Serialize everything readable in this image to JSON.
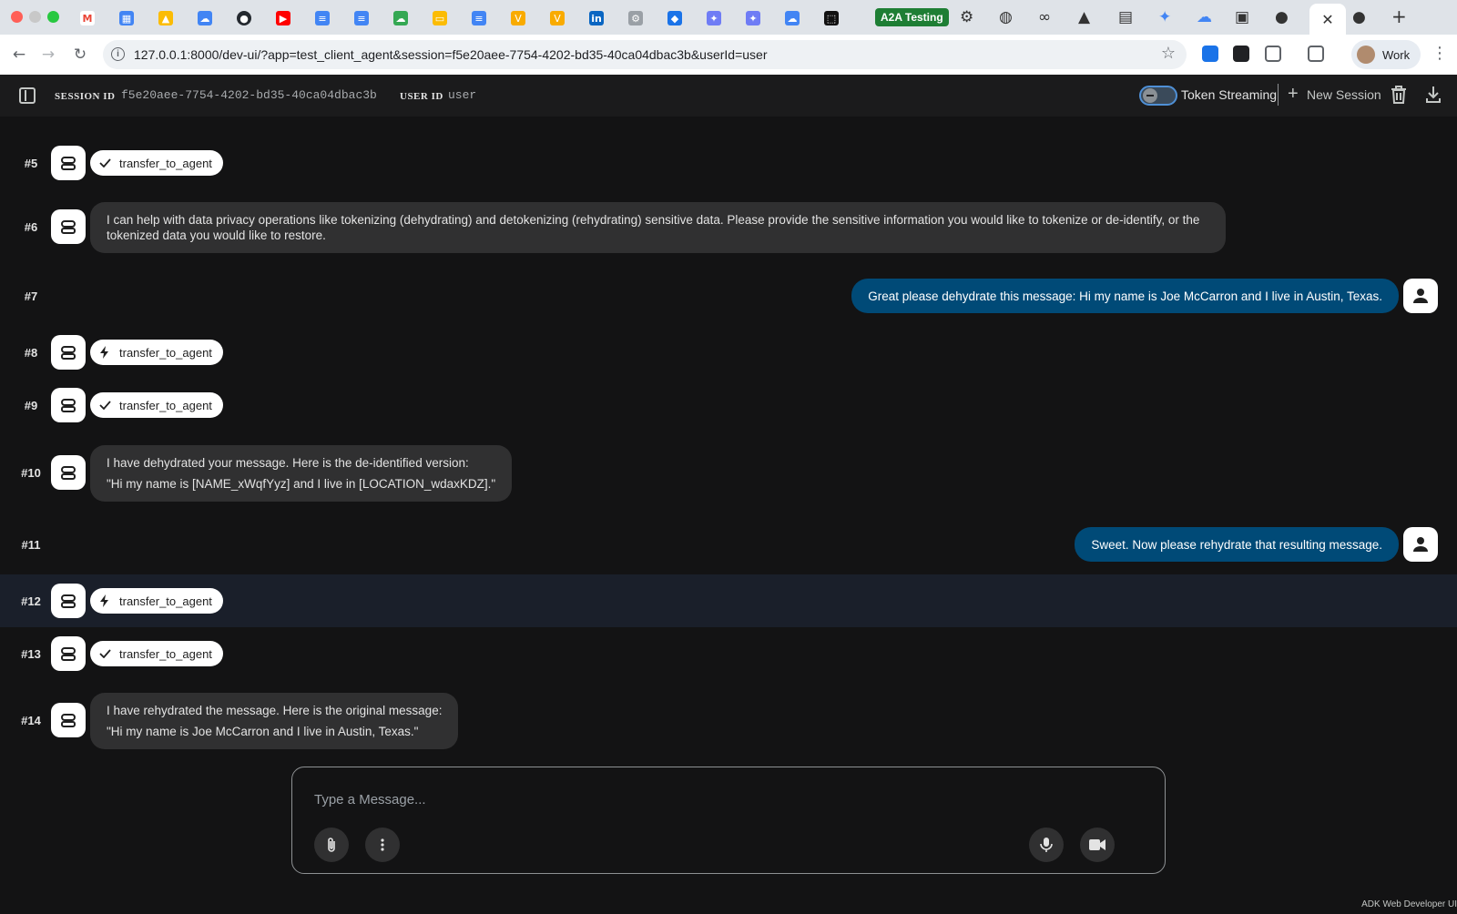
{
  "browser": {
    "a2a_tab_label": "A2A Testing",
    "active_tab_close": "✕",
    "new_tab": "+",
    "url": "127.0.0.1:8000/dev-ui/?app=test_client_agent&session=f5e20aee-7754-4202-bd35-40ca04dbac3b&userId=user",
    "profile_label": "Work"
  },
  "header": {
    "session_label": "SESSION ID",
    "session_id": "f5e20aee-7754-4202-bd35-40ca04dbac3b",
    "user_label": "USER ID",
    "user_id": "user",
    "token_streaming_label": "Token Streaming",
    "new_session_label": "New Session"
  },
  "messages": [
    {
      "num": "#5",
      "role": "bot",
      "kind": "function_response",
      "label": "transfer_to_agent"
    },
    {
      "num": "#6",
      "role": "bot",
      "kind": "text",
      "lines": [
        "I can help with data privacy operations like tokenizing (dehydrating) and detokenizing (rehydrating) sensitive data. Please provide the sensitive information you would like to tokenize or de-identify, or the",
        "tokenized data you would like to restore."
      ]
    },
    {
      "num": "#7",
      "role": "user",
      "kind": "text",
      "text": "Great please dehydrate this message: Hi my name is Joe McCarron and I live in Austin, Texas."
    },
    {
      "num": "#8",
      "role": "bot",
      "kind": "function_call",
      "label": "transfer_to_agent"
    },
    {
      "num": "#9",
      "role": "bot",
      "kind": "function_response",
      "label": "transfer_to_agent"
    },
    {
      "num": "#10",
      "role": "bot",
      "kind": "text",
      "lines": [
        "I have dehydrated your message. Here is the de-identified version:",
        "\"Hi my name is [NAME_xWqfYyz] and I live in [LOCATION_wdaxKDZ].\""
      ]
    },
    {
      "num": "#11",
      "role": "user",
      "kind": "text",
      "text": "Sweet. Now please rehydrate that resulting message."
    },
    {
      "num": "#12",
      "role": "bot",
      "kind": "function_call",
      "label": "transfer_to_agent"
    },
    {
      "num": "#13",
      "role": "bot",
      "kind": "function_response",
      "label": "transfer_to_agent"
    },
    {
      "num": "#14",
      "role": "bot",
      "kind": "text",
      "lines": [
        "I have rehydrated the message. Here is the original message:",
        "\"Hi my name is Joe McCarron and I live in Austin, Texas.\""
      ]
    }
  ],
  "composer": {
    "placeholder": "Type a Message..."
  },
  "footer": {
    "text": "ADK Web Developer UI"
  },
  "colors": {
    "background": "#131314",
    "user_bubble": "#004a77",
    "bot_bubble": "#303031",
    "highlight_row": "#1a1f2a"
  }
}
